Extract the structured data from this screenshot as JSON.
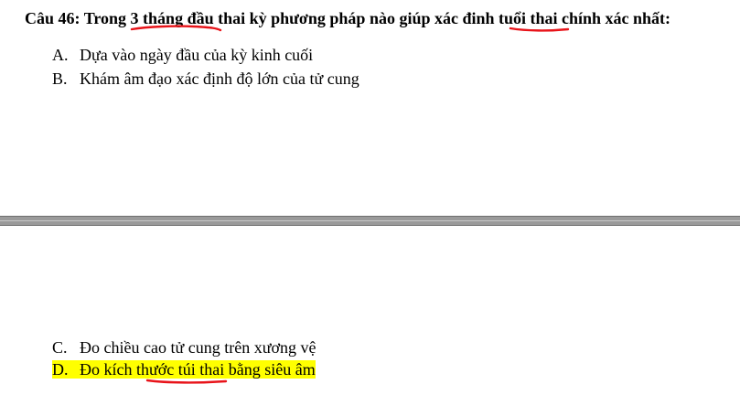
{
  "question": {
    "number_label": "Câu 46:",
    "part_before_1": " Trong ",
    "emphasis_1": "3 tháng đầu",
    "part_between": " thai kỳ phương pháp nào giúp xác đinh ",
    "emphasis_2": "tuổi thai",
    "part_after": " chính xác nhất:"
  },
  "options": [
    {
      "letter": "A.",
      "text": "Dựa vào ngày đầu của kỳ kinh cuối"
    },
    {
      "letter": "B.",
      "text": "Khám âm đạo xác định độ lớn của tử cung"
    },
    {
      "letter": "C.",
      "text": "Đo chiều cao tử cung trên xương vệ"
    },
    {
      "letter": "D.",
      "text": "Đo kích thước túi thai bằng siêu âm",
      "highlighted": true
    }
  ],
  "colors": {
    "highlight": "#ffff00",
    "pen_annotation": "#e8141a",
    "separator": "#9a9a9a"
  }
}
